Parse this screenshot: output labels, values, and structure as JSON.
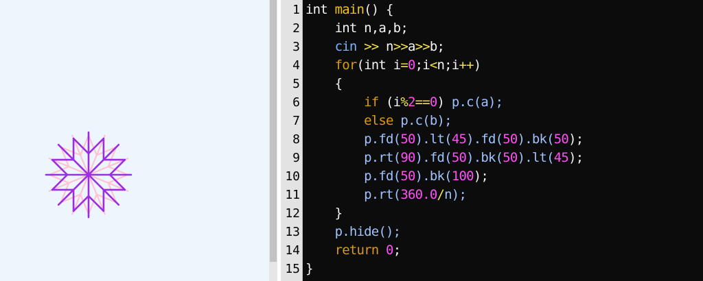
{
  "colors": {
    "canvas_bg": "#eef6fd",
    "editor_bg": "#0c0c0c",
    "gutter_bg": "#e3e3e3",
    "turtle_odd": "#9b2fe0",
    "turtle_even": "#ffc2cf",
    "keyword": "#f5f5f5",
    "function": "#f2c21b",
    "control": "#d99a14",
    "number": "#ff4ff7",
    "operator": "#f2e24a",
    "object": "#9fc3ff"
  },
  "canvas": {
    "figure": "snowflake-turtle-drawing"
  },
  "editor": {
    "lines": [
      {
        "number": "1",
        "indent": "",
        "tokens": [
          {
            "text": "int ",
            "kind": "kw"
          },
          {
            "text": "main",
            "kind": "fn"
          },
          {
            "text": "() {",
            "kind": "punc"
          }
        ]
      },
      {
        "number": "2",
        "indent": "    ",
        "tokens": [
          {
            "text": "int ",
            "kind": "ty"
          },
          {
            "text": "n,a,b;",
            "kind": "id"
          }
        ]
      },
      {
        "number": "3",
        "indent": "    ",
        "tokens": [
          {
            "text": "cin ",
            "kind": "cin"
          },
          {
            "text": ">> ",
            "kind": "op"
          },
          {
            "text": "n",
            "kind": "id"
          },
          {
            "text": ">>",
            "kind": "op"
          },
          {
            "text": "a",
            "kind": "id"
          },
          {
            "text": ">>",
            "kind": "op"
          },
          {
            "text": "b;",
            "kind": "id"
          }
        ]
      },
      {
        "number": "4",
        "indent": "    ",
        "tokens": [
          {
            "text": "for",
            "kind": "ctl"
          },
          {
            "text": "(",
            "kind": "punc"
          },
          {
            "text": "int ",
            "kind": "ty"
          },
          {
            "text": "i",
            "kind": "id"
          },
          {
            "text": "=",
            "kind": "op"
          },
          {
            "text": "0",
            "kind": "num"
          },
          {
            "text": ";i",
            "kind": "id"
          },
          {
            "text": "<",
            "kind": "op"
          },
          {
            "text": "n;i",
            "kind": "id"
          },
          {
            "text": "++",
            "kind": "op"
          },
          {
            "text": ")",
            "kind": "punc"
          }
        ]
      },
      {
        "number": "5",
        "indent": "    ",
        "tokens": [
          {
            "text": "{",
            "kind": "punc"
          }
        ]
      },
      {
        "number": "6",
        "indent": "        ",
        "tokens": [
          {
            "text": "if ",
            "kind": "ctl"
          },
          {
            "text": "(i",
            "kind": "id"
          },
          {
            "text": "%",
            "kind": "op"
          },
          {
            "text": "2",
            "kind": "num"
          },
          {
            "text": "==",
            "kind": "op"
          },
          {
            "text": "0",
            "kind": "num"
          },
          {
            "text": ") ",
            "kind": "punc"
          },
          {
            "text": "p.c(a);",
            "kind": "obj"
          }
        ]
      },
      {
        "number": "7",
        "indent": "        ",
        "tokens": [
          {
            "text": "else ",
            "kind": "ctl"
          },
          {
            "text": "p.c(b);",
            "kind": "obj"
          }
        ]
      },
      {
        "number": "8",
        "indent": "        ",
        "tokens": [
          {
            "text": "p.fd(",
            "kind": "obj"
          },
          {
            "text": "50",
            "kind": "num"
          },
          {
            "text": ").lt(",
            "kind": "obj"
          },
          {
            "text": "45",
            "kind": "num"
          },
          {
            "text": ").fd(",
            "kind": "obj"
          },
          {
            "text": "50",
            "kind": "num"
          },
          {
            "text": ").bk(",
            "kind": "obj"
          },
          {
            "text": "50",
            "kind": "num"
          },
          {
            "text": ");",
            "kind": "punc"
          }
        ]
      },
      {
        "number": "9",
        "indent": "        ",
        "tokens": [
          {
            "text": "p.rt(",
            "kind": "obj"
          },
          {
            "text": "90",
            "kind": "num"
          },
          {
            "text": ").fd(",
            "kind": "obj"
          },
          {
            "text": "50",
            "kind": "num"
          },
          {
            "text": ").bk(",
            "kind": "obj"
          },
          {
            "text": "50",
            "kind": "num"
          },
          {
            "text": ").lt(",
            "kind": "obj"
          },
          {
            "text": "45",
            "kind": "num"
          },
          {
            "text": ");",
            "kind": "punc"
          }
        ]
      },
      {
        "number": "10",
        "indent": "        ",
        "tokens": [
          {
            "text": "p.fd(",
            "kind": "obj"
          },
          {
            "text": "50",
            "kind": "num"
          },
          {
            "text": ").bk(",
            "kind": "obj"
          },
          {
            "text": "100",
            "kind": "num"
          },
          {
            "text": ");",
            "kind": "punc"
          }
        ]
      },
      {
        "number": "11",
        "indent": "        ",
        "tokens": [
          {
            "text": "p.rt(",
            "kind": "obj"
          },
          {
            "text": "360.0",
            "kind": "num"
          },
          {
            "text": "/",
            "kind": "op"
          },
          {
            "text": "n);",
            "kind": "obj"
          }
        ]
      },
      {
        "number": "12",
        "indent": "    ",
        "tokens": [
          {
            "text": "}",
            "kind": "punc"
          }
        ]
      },
      {
        "number": "13",
        "indent": "    ",
        "tokens": [
          {
            "text": "p.hide();",
            "kind": "obj"
          }
        ]
      },
      {
        "number": "14",
        "indent": "    ",
        "tokens": [
          {
            "text": "return ",
            "kind": "ctl"
          },
          {
            "text": "0",
            "kind": "num"
          },
          {
            "text": ";",
            "kind": "punc"
          }
        ]
      },
      {
        "number": "15",
        "indent": "",
        "tokens": [
          {
            "text": "}",
            "kind": "punc"
          }
        ]
      }
    ]
  }
}
